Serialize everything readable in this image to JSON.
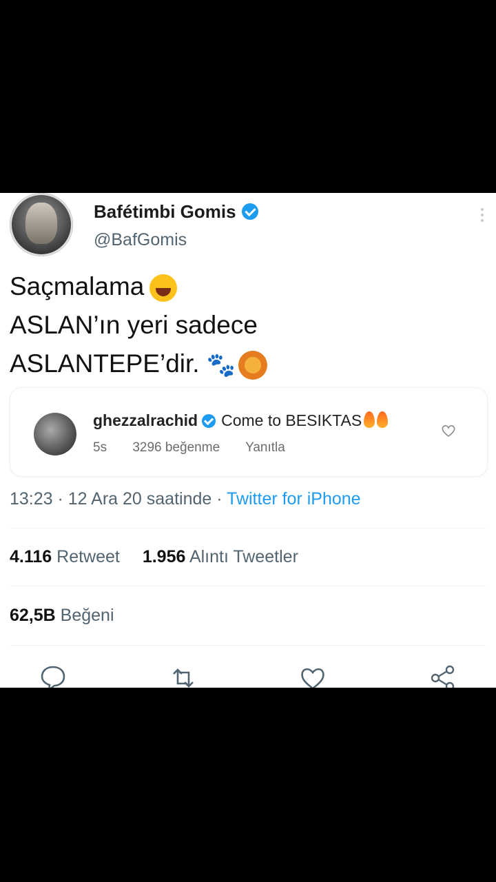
{
  "author": {
    "name": "Bafétimbi Gomis",
    "handle": "@BafGomis"
  },
  "tweet": {
    "lines": [
      "Saçmalama",
      "ASLAN’ın yeri sadece",
      "ASLANTEPE’dir."
    ]
  },
  "reply": {
    "username": "ghezzalrachid",
    "text": "Come to BESIKTAS",
    "time": "5s",
    "likes": "3296 beğenme",
    "reply_label": "Yanıtla"
  },
  "meta": {
    "time_date": "13:23 · 12 Ara 20 saatinde · ",
    "source": "Twitter for iPhone"
  },
  "stats": {
    "retweets": "4.116",
    "retweets_label": "Retweet",
    "quotes": "1.956",
    "quotes_label": "Alıntı Tweetler",
    "likes": "62,5B",
    "likes_label": "Beğeni"
  },
  "colors": {
    "accent": "#1d9bf0",
    "muted": "#536471",
    "background_bars": "#000000"
  },
  "icons": [
    "verified-icon",
    "more-icon",
    "reply-icon",
    "retweet-icon",
    "like-icon",
    "share-icon",
    "heart-icon"
  ]
}
